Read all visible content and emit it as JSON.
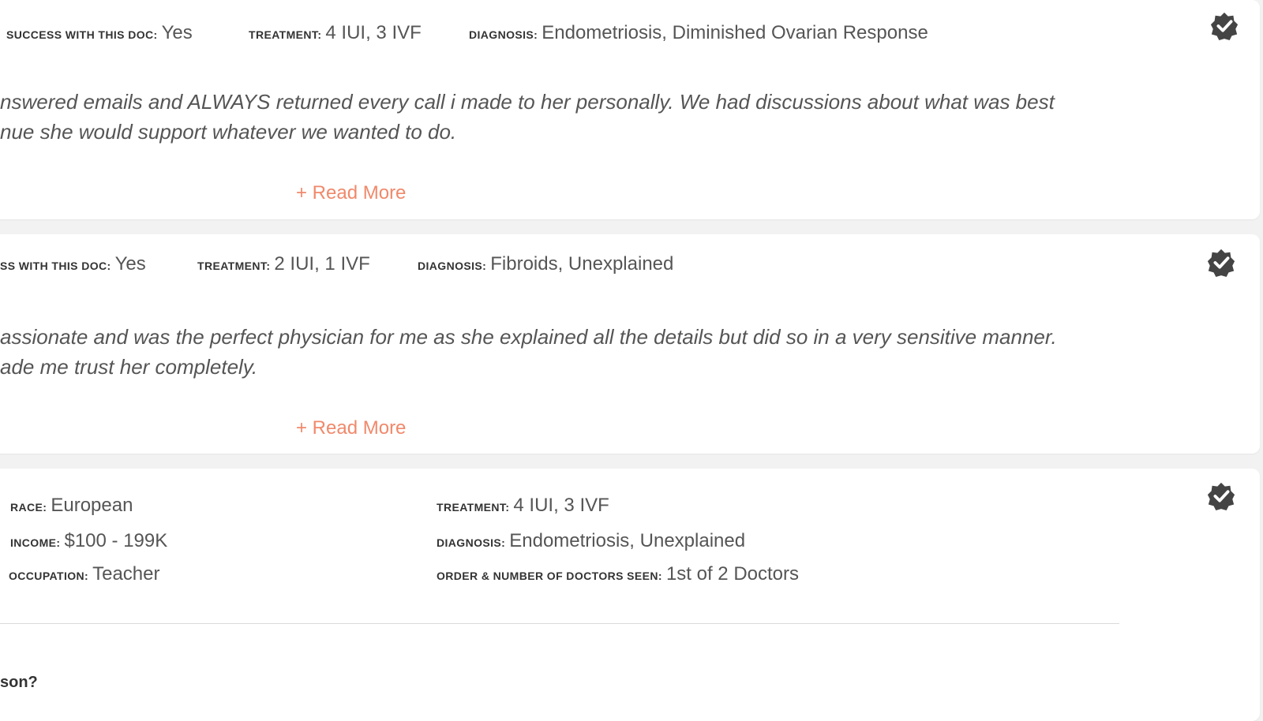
{
  "reviews": [
    {
      "success_label": "SUCCESS WITH THIS DOC:",
      "success_value": "Yes",
      "treatment_label": "TREATMENT:",
      "treatment_value": "4 IUI, 3 IVF",
      "diagnosis_label": "DIAGNOSIS:",
      "diagnosis_value": "Endometriosis, Diminished Ovarian Response",
      "quote_lines": [
        "nswered emails and ALWAYS returned every call i made to her personally. We had discussions about what was best",
        "nue she would support whatever we wanted to do."
      ],
      "read_more": "+ Read More",
      "verified_icon": "verified-check-badge"
    },
    {
      "success_label": "SS WITH THIS DOC:",
      "success_value": "Yes",
      "treatment_label": "TREATMENT:",
      "treatment_value": "2 IUI, 1 IVF",
      "diagnosis_label": "DIAGNOSIS:",
      "diagnosis_value": "Fibroids, Unexplained",
      "quote_lines": [
        "assionate and was the perfect physician for me as she explained all the details but did so in a very sensitive manner.",
        "ade me trust her completely."
      ],
      "read_more": "+ Read More",
      "verified_icon": "verified-check-badge"
    }
  ],
  "profile": {
    "race_label": "RACE:",
    "race_value": "European",
    "income_label": "INCOME:",
    "income_value": "$100 - 199K",
    "occupation_label": "OCCUPATION:",
    "occupation_value": "Teacher",
    "treatment_label": "TREATMENT:",
    "treatment_value": "4 IUI, 3 IVF",
    "diagnosis_label": "DIAGNOSIS:",
    "diagnosis_value": "Endometriosis, Unexplained",
    "order_label": "ORDER & NUMBER OF DOCTORS SEEN:",
    "order_value": "1st of 2 Doctors",
    "verified_icon": "verified-check-badge",
    "question_fragment": "son?"
  },
  "colors": {
    "accent": "#f0896b",
    "badge": "#444444",
    "background": "#f2f2f2"
  }
}
